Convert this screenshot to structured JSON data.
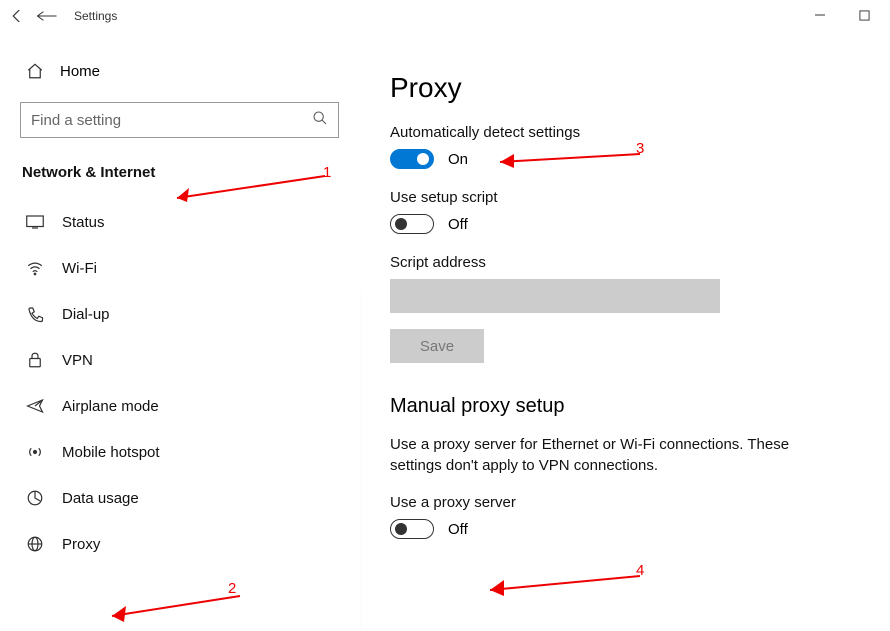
{
  "titlebar": {
    "title": "Settings"
  },
  "sidebar": {
    "home": "Home",
    "search_placeholder": "Find a setting",
    "section": "Network & Internet",
    "items": [
      {
        "label": "Status"
      },
      {
        "label": "Wi-Fi"
      },
      {
        "label": "Dial-up"
      },
      {
        "label": "VPN"
      },
      {
        "label": "Airplane mode"
      },
      {
        "label": "Mobile hotspot"
      },
      {
        "label": "Data usage"
      },
      {
        "label": "Proxy"
      }
    ]
  },
  "content": {
    "title": "Proxy",
    "auto_detect": {
      "label": "Automatically detect settings",
      "state": "On"
    },
    "setup_script": {
      "label": "Use setup script",
      "state": "Off"
    },
    "script_address_label": "Script address",
    "save": "Save",
    "manual_heading": "Manual proxy setup",
    "manual_desc": "Use a proxy server for Ethernet or Wi-Fi connections. These settings don't apply to VPN connections.",
    "use_proxy": {
      "label": "Use a proxy server",
      "state": "Off"
    }
  },
  "annotations": {
    "n1": "1",
    "n2": "2",
    "n3": "3",
    "n4": "4"
  }
}
